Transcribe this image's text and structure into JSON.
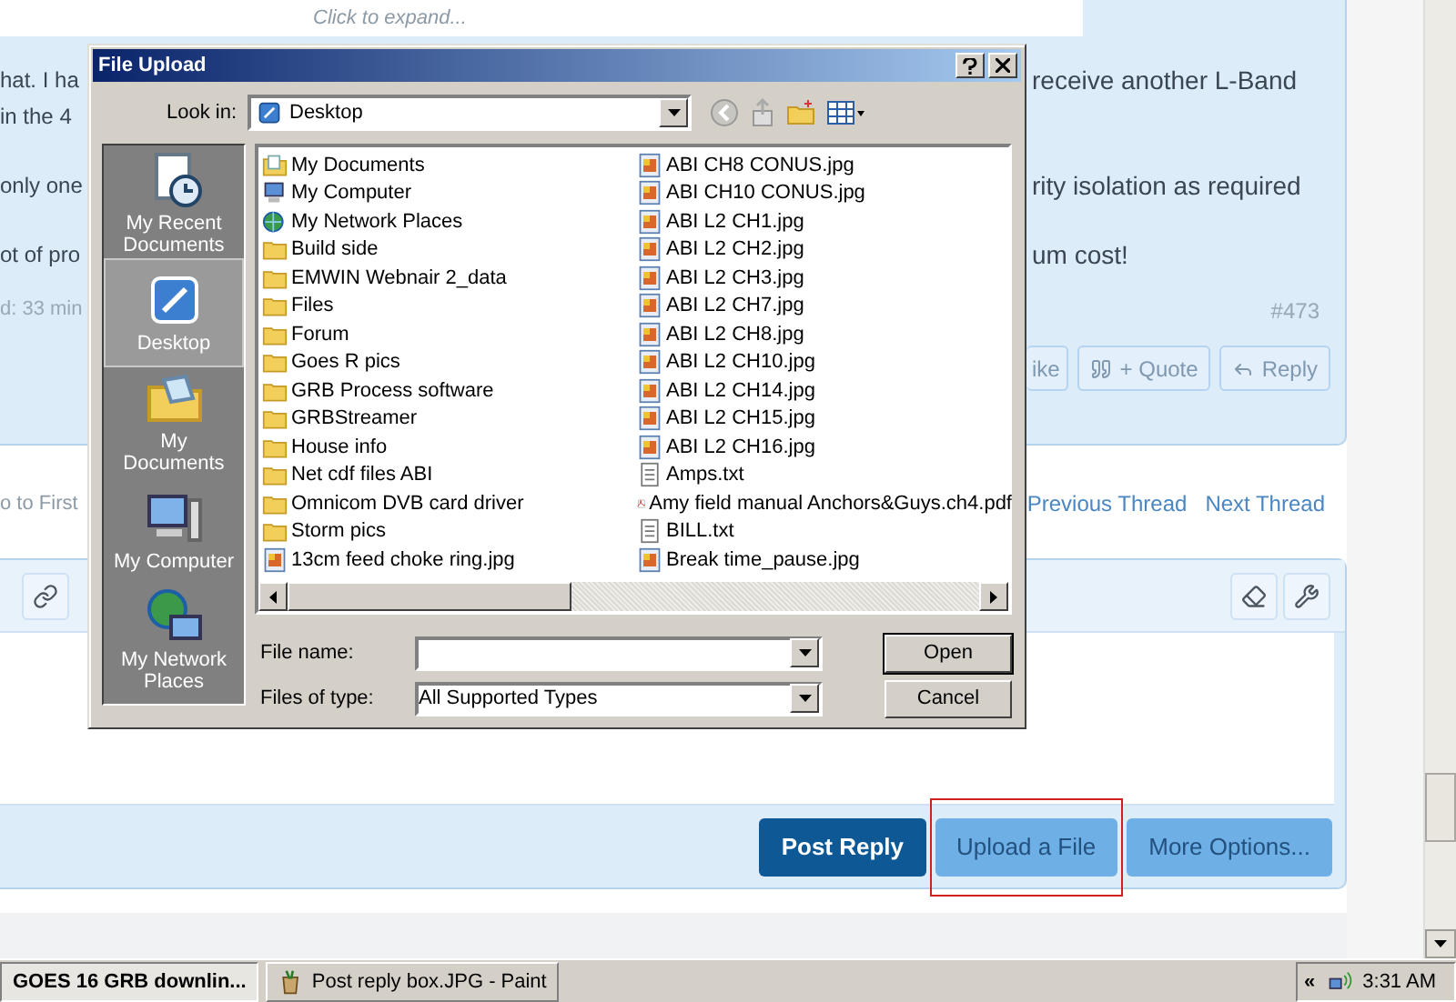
{
  "page": {
    "quote_hint": "Click to expand...",
    "paragraphs": [
      {
        "lines": [
          {
            "left": "hat. I ha",
            "right": "receive another L-Band"
          },
          {
            "left": "in the 4"
          }
        ]
      },
      {
        "lines": [
          {
            "left": "only one",
            "right": "rity isolation as required"
          }
        ]
      },
      {
        "lines": [
          {
            "left": "ot of pro",
            "right": "um cost!"
          }
        ]
      }
    ],
    "post_date": "d: 33 min",
    "post_number": "#473",
    "post_actions": [
      {
        "label": "ike",
        "kind": "like"
      },
      {
        "label": "+ Quote",
        "kind": "quote"
      },
      {
        "label": "Reply",
        "kind": "reply"
      }
    ],
    "thread_nav": {
      "first": "o to First",
      "links": [
        "Previous Thread",
        "Next Thread"
      ]
    },
    "reply_buttons": [
      {
        "label": "Post Reply",
        "kind": "primary",
        "marked": false
      },
      {
        "label": "Upload a File",
        "kind": "secondary",
        "marked": true
      },
      {
        "label": "More Options...",
        "kind": "secondary",
        "marked": false
      }
    ]
  },
  "dialog": {
    "title": "File Upload",
    "look_in": {
      "label": "Look in:",
      "value": "Desktop"
    },
    "places": [
      {
        "label": "My Recent Documents",
        "kind": "recent",
        "selected": false
      },
      {
        "label": "Desktop",
        "kind": "desktop",
        "selected": true
      },
      {
        "label": "My Documents",
        "kind": "documents",
        "selected": false
      },
      {
        "label": "My Computer",
        "kind": "computer",
        "selected": false
      },
      {
        "label": "My Network Places",
        "kind": "network",
        "selected": false
      }
    ],
    "files": [
      {
        "name": "My Documents",
        "kind": "documents"
      },
      {
        "name": "My Computer",
        "kind": "computer"
      },
      {
        "name": "My Network Places",
        "kind": "network"
      },
      {
        "name": "Build side",
        "kind": "folder"
      },
      {
        "name": "EMWIN Webnair 2_data",
        "kind": "folder"
      },
      {
        "name": "Files",
        "kind": "folder"
      },
      {
        "name": "Forum",
        "kind": "folder"
      },
      {
        "name": "Goes R pics",
        "kind": "folder"
      },
      {
        "name": "GRB Process software",
        "kind": "folder"
      },
      {
        "name": "GRBStreamer",
        "kind": "folder"
      },
      {
        "name": "House info",
        "kind": "folder"
      },
      {
        "name": "Net cdf files ABI",
        "kind": "folder"
      },
      {
        "name": "Omnicom DVB card driver",
        "kind": "folder"
      },
      {
        "name": "Storm pics",
        "kind": "folder"
      },
      {
        "name": "13cm feed choke ring.jpg",
        "kind": "image"
      },
      {
        "name": "ABI CH8 CONUS.jpg",
        "kind": "image"
      },
      {
        "name": "ABI CH10 CONUS.jpg",
        "kind": "image"
      },
      {
        "name": "ABI L2 CH1.jpg",
        "kind": "image"
      },
      {
        "name": "ABI L2 CH2.jpg",
        "kind": "image"
      },
      {
        "name": "ABI L2 CH3.jpg",
        "kind": "image"
      },
      {
        "name": "ABI L2 CH7.jpg",
        "kind": "image"
      },
      {
        "name": "ABI L2 CH8.jpg",
        "kind": "image"
      },
      {
        "name": "ABI L2 CH10.jpg",
        "kind": "image"
      },
      {
        "name": "ABI L2 CH14.jpg",
        "kind": "image"
      },
      {
        "name": "ABI L2 CH15.jpg",
        "kind": "image"
      },
      {
        "name": "ABI L2 CH16.jpg",
        "kind": "image"
      },
      {
        "name": "Amps.txt",
        "kind": "text"
      },
      {
        "name": "Amy field manual Anchors&Guys.ch4.pdf",
        "kind": "pdf"
      },
      {
        "name": "BILL.txt",
        "kind": "text"
      },
      {
        "name": "Break time_pause.jpg",
        "kind": "image"
      }
    ],
    "file_name": {
      "label": "File name:"
    },
    "file_type": {
      "label": "Files of type:",
      "value": "All Supported Types"
    },
    "buttons": [
      "Open",
      "Cancel"
    ]
  },
  "taskbar": {
    "tasks": [
      {
        "label": "GOES 16 GRB downlin...",
        "kind": "browser",
        "selected": true
      },
      {
        "label": "Post reply box.JPG - Paint",
        "kind": "paint",
        "selected": false
      }
    ],
    "tray_toggle": "«",
    "clock": "3:31 AM"
  }
}
